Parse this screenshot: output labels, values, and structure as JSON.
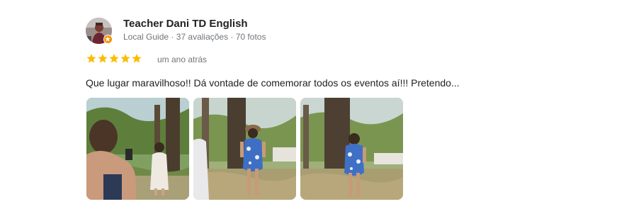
{
  "reviewer": {
    "name": "Teacher Dani TD English",
    "meta": "Local Guide · 37 avaliações · 70 fotos",
    "avatar_icon": "avatar-photo",
    "badge_icon": "local-guide-star-icon"
  },
  "rating": {
    "stars": 5,
    "max": 5,
    "star_color": "#fbbc04",
    "time": "um ano atrás"
  },
  "review_text": "Que lugar maravilhoso!! Dá vontade de comemorar todos os eventos aí!!! Pretendo...",
  "photos": [
    {
      "description_icon": "review-photo-1"
    },
    {
      "description_icon": "review-photo-2"
    },
    {
      "description_icon": "review-photo-3"
    }
  ],
  "colors": {
    "name": "#202124",
    "secondary": "#70757a",
    "badge": "#f29300"
  }
}
